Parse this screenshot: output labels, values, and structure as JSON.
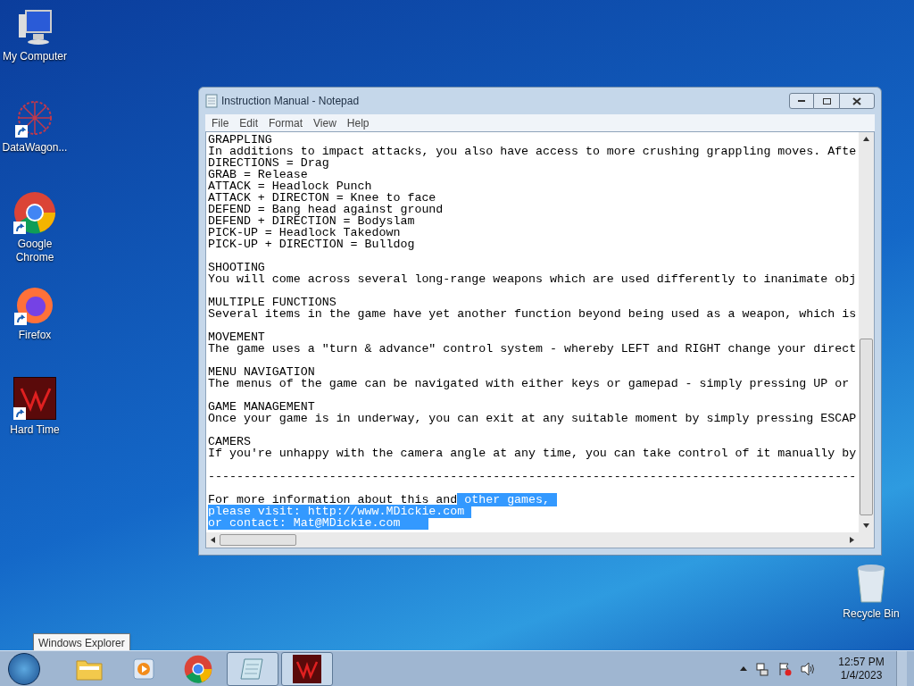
{
  "desktop_icons": [
    {
      "label": "My Computer",
      "kind": "computer"
    },
    {
      "label": "DataWagon...",
      "kind": "web"
    },
    {
      "label": "Google Chrome",
      "kind": "chrome"
    },
    {
      "label": "Firefox",
      "kind": "firefox"
    },
    {
      "label": "Hard Time",
      "kind": "game"
    },
    {
      "label": "Recycle Bin",
      "kind": "bin"
    }
  ],
  "window": {
    "title": "Instruction Manual - Notepad",
    "menu": [
      "File",
      "Edit",
      "Format",
      "View",
      "Help"
    ],
    "sections": [
      [
        {
          "text": "GRAPPLING"
        },
        {
          "text": "In additions to impact attacks, you also have access to more crushing grappling moves. Afte"
        },
        {
          "text": "DIRECTIONS = Drag"
        },
        {
          "text": "GRAB = Release"
        },
        {
          "text": "ATTACK = Headlock Punch"
        },
        {
          "text": "ATTACK + DIRECTON = Knee to face"
        },
        {
          "text": "DEFEND = Bang head against ground"
        },
        {
          "text": "DEFEND + DIRECTION = Bodyslam"
        },
        {
          "text": "PICK-UP = Headlock Takedown"
        },
        {
          "text": "PICK-UP + DIRECTION = Bulldog"
        }
      ],
      [
        {
          "text": "SHOOTING"
        },
        {
          "text": "You will come across several long-range weapons which are used differently to inanimate obj"
        }
      ],
      [
        {
          "text": "MULTIPLE FUNCTIONS"
        },
        {
          "text": "Several items in the game have yet another function beyond being used as a weapon, which is"
        }
      ],
      [
        {
          "text": "MOVEMENT"
        },
        {
          "text": "The game uses a \"turn & advance\" control system - whereby LEFT and RIGHT change your direct"
        }
      ],
      [
        {
          "text": "MENU NAVIGATION"
        },
        {
          "text": "The menus of the game can be navigated with either keys or gamepad - simply pressing UP or"
        }
      ],
      [
        {
          "text": "GAME MANAGEMENT"
        },
        {
          "text": "Once your game is in underway, you can exit at any suitable moment by simply pressing ESCAP"
        }
      ],
      [
        {
          "text": "CAMERS"
        },
        {
          "text": "If you're unhappy with the camera angle at any time, you can take control of it manually by"
        }
      ],
      [
        {
          "text": "-------------------------------------------------------------------------------------------"
        }
      ],
      [
        {
          "text": "For more information about this and",
          "highlight": " other games, "
        },
        {
          "highlight": "please visit: http://www.MDickie.com "
        },
        {
          "highlight": "or contact: Mat@MDickie.com    "
        }
      ]
    ]
  },
  "tooltip": "Windows Explorer",
  "taskbar": {
    "items": [
      {
        "kind": "explorer",
        "selected": false
      },
      {
        "kind": "media",
        "selected": false
      },
      {
        "kind": "chrome",
        "selected": false
      },
      {
        "kind": "notepad",
        "selected": true
      },
      {
        "kind": "game",
        "selected": true
      }
    ],
    "time": "12:57 PM",
    "date": "1/4/2023"
  }
}
